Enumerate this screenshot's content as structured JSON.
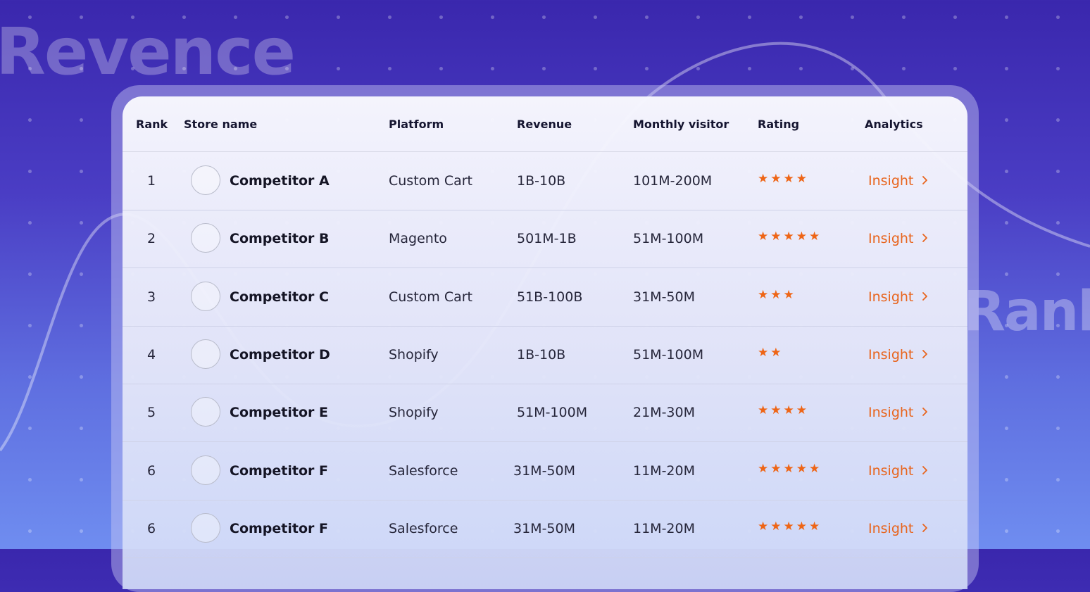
{
  "background": {
    "word_left": "Revence",
    "word_right": "Rank",
    "gradient_top": "#3a27ad",
    "gradient_bottom": "#6f8df0"
  },
  "table": {
    "headers": {
      "rank": "Rank",
      "store": "Store name",
      "platform": "Platform",
      "revenue": "Revenue",
      "visitors": "Monthly visitor",
      "rating": "Rating",
      "analytics": "Analytics"
    },
    "star_color": "#ee6516",
    "link_color": "#e8641c",
    "rows": [
      {
        "rank": "1",
        "name": "Competitor A",
        "platform": "Custom Cart",
        "revenue": "1B-10B",
        "visitors": "101M-200M",
        "rating": 4,
        "stars": "★★★★",
        "link": "Insight"
      },
      {
        "rank": "2",
        "name": "Competitor B",
        "platform": "Magento",
        "revenue": "501M-1B",
        "visitors": "51M-100M",
        "rating": 5,
        "stars": "★★★★★",
        "link": "Insight"
      },
      {
        "rank": "3",
        "name": "Competitor C",
        "platform": "Custom Cart",
        "revenue": "51B-100B",
        "visitors": "31M-50M",
        "rating": 3,
        "stars": "★★★",
        "link": "Insight"
      },
      {
        "rank": "4",
        "name": "Competitor D",
        "platform": "Shopify",
        "revenue": "1B-10B",
        "visitors": "51M-100M",
        "rating": 2,
        "stars": "★★",
        "link": "Insight"
      },
      {
        "rank": "5",
        "name": "Competitor E",
        "platform": "Shopify",
        "revenue": "51M-100M",
        "visitors": "21M-30M",
        "rating": 4,
        "stars": "★★★★",
        "link": "Insight"
      },
      {
        "rank": "6",
        "name": "Competitor F",
        "platform": "Salesforce",
        "revenue": "31M-50M",
        "visitors": "11M-20M",
        "rating": 5,
        "stars": "★★★★★",
        "link": "Insight"
      },
      {
        "rank": "6",
        "name": "Competitor F",
        "platform": "Salesforce",
        "revenue": "31M-50M",
        "visitors": "11M-20M",
        "rating": 5,
        "stars": "★★★★★",
        "link": "Insight"
      }
    ]
  }
}
